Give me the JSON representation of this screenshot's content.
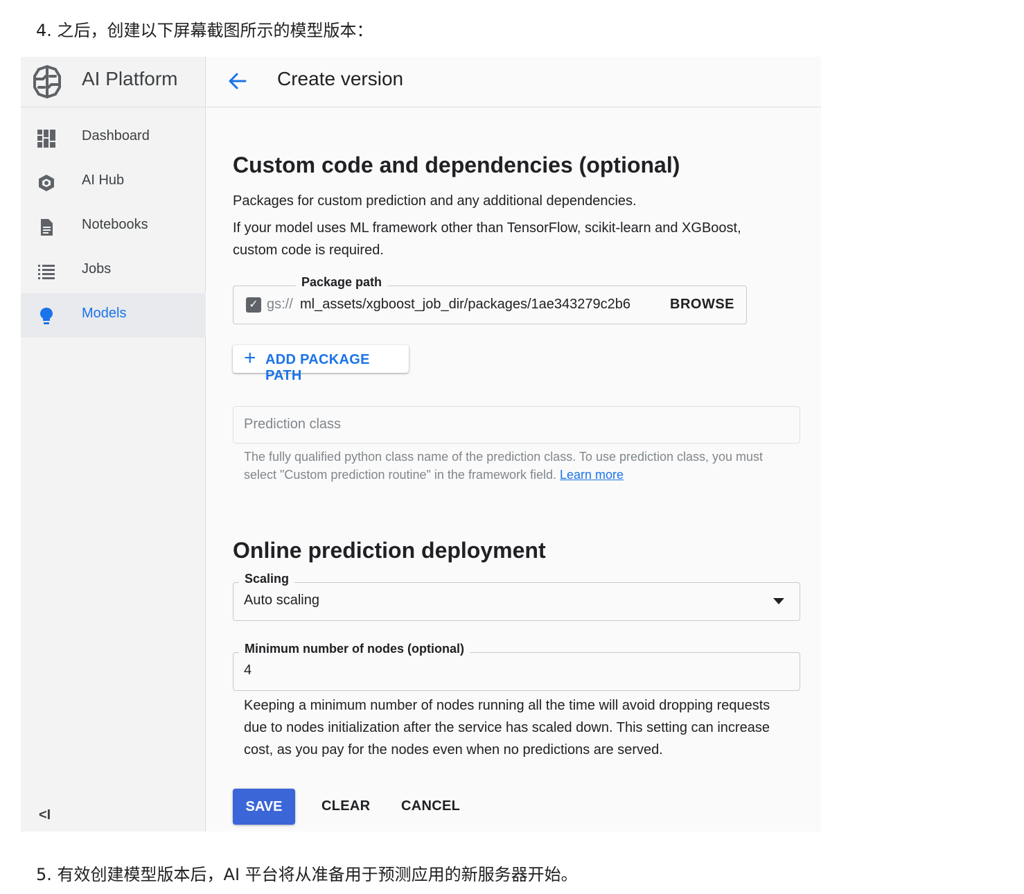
{
  "doc": {
    "step4": "4. 之后，创建以下屏幕截图所示的模型版本：",
    "step5": "5. 有效创建模型版本后，AI 平台将从准备用于预测应用的新服务器开始。"
  },
  "app": {
    "name": "AI Platform",
    "logo_icon": "ai-platform-brain-icon"
  },
  "sidebar": {
    "items": [
      {
        "label": "Dashboard",
        "icon": "dashboard-icon",
        "active": false
      },
      {
        "label": "AI Hub",
        "icon": "ai-hub-icon",
        "active": false
      },
      {
        "label": "Notebooks",
        "icon": "notebook-icon",
        "active": false
      },
      {
        "label": "Jobs",
        "icon": "list-icon",
        "active": false
      },
      {
        "label": "Models",
        "icon": "lightbulb-icon",
        "active": true
      }
    ],
    "collapse_label": "<I"
  },
  "header": {
    "title": "Create version",
    "back_icon": "arrow-back-icon"
  },
  "custom_code": {
    "heading": "Custom code and dependencies (optional)",
    "desc1": "Packages for custom prediction and any additional dependencies.",
    "desc2": "If your model uses ML framework other than TensorFlow, scikit-learn and XGBoost, custom code is required.",
    "package_path": {
      "label": "Package path",
      "checked": true,
      "prefix": "gs://",
      "value": "ml_assets/xgboost_job_dir/packages/1ae343279c2b6",
      "browse_label": "BROWSE"
    },
    "add_package_label": "ADD PACKAGE PATH",
    "prediction_class": {
      "placeholder": "Prediction class",
      "hint": "The fully qualified python class name of the prediction class. To use prediction class, you must select \"Custom prediction routine\" in the framework field.",
      "learn_more": "Learn more"
    }
  },
  "deployment": {
    "heading": "Online prediction deployment",
    "scaling": {
      "label": "Scaling",
      "value": "Auto scaling"
    },
    "min_nodes": {
      "label": "Minimum number of nodes (optional)",
      "value": "4",
      "help": "Keeping a minimum number of nodes running all the time will avoid dropping requests due to nodes initialization after the service has scaled down. This setting can increase cost, as you pay for the nodes even when no predictions are served."
    }
  },
  "actions": {
    "save": "SAVE",
    "clear": "CLEAR",
    "cancel": "CANCEL"
  },
  "colors": {
    "accent": "#1a73e8",
    "save_button": "#3b66d8",
    "sidebar_bg": "#f3f3f3",
    "active_item_bg": "#e8eaed"
  }
}
